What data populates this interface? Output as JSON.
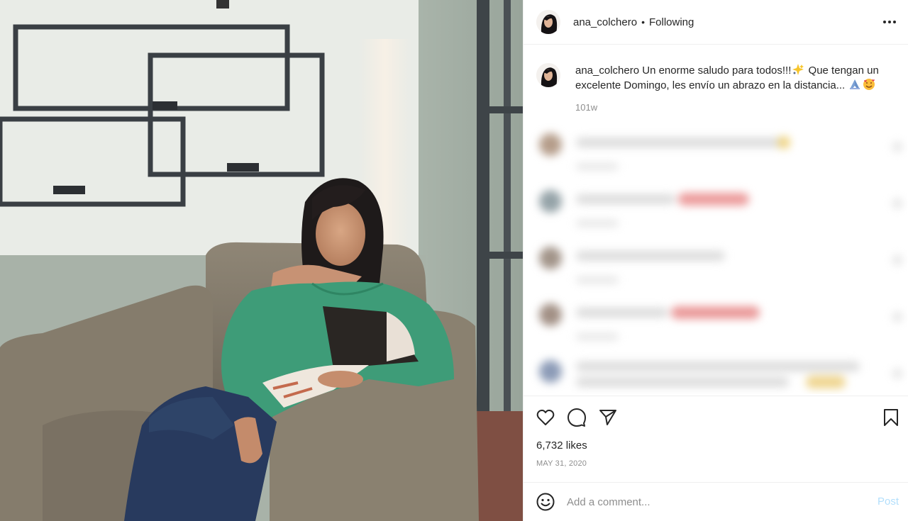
{
  "post": {
    "username": "ana_colchero",
    "separator": "•",
    "follow_state": "Following",
    "more_icon": "more-horizontal-icon"
  },
  "caption": {
    "username": "ana_colchero",
    "text_part1": "Un enorme saludo para todos!!!",
    "text_part2": " Que tengan un excelente Domingo, les envío un abrazo en la distancia...",
    "emojis": [
      "sparkle-emoji",
      "praying-hands-emoji",
      "smiling-hearts-emoji"
    ],
    "time": "101w"
  },
  "actions": {
    "like_icon": "heart-icon",
    "comment_icon": "comment-icon",
    "share_icon": "paper-plane-icon",
    "save_icon": "bookmark-icon"
  },
  "likes": "6,732 likes",
  "date": "MAY 31, 2020",
  "comment_bar": {
    "emoji_icon": "smiley-icon",
    "placeholder": "Add a comment...",
    "post_label": "Post"
  },
  "colors": {
    "text": "#262626",
    "secondary": "#8e8e8e",
    "post_disabled": "#b2dffc",
    "border": "#efefef"
  }
}
